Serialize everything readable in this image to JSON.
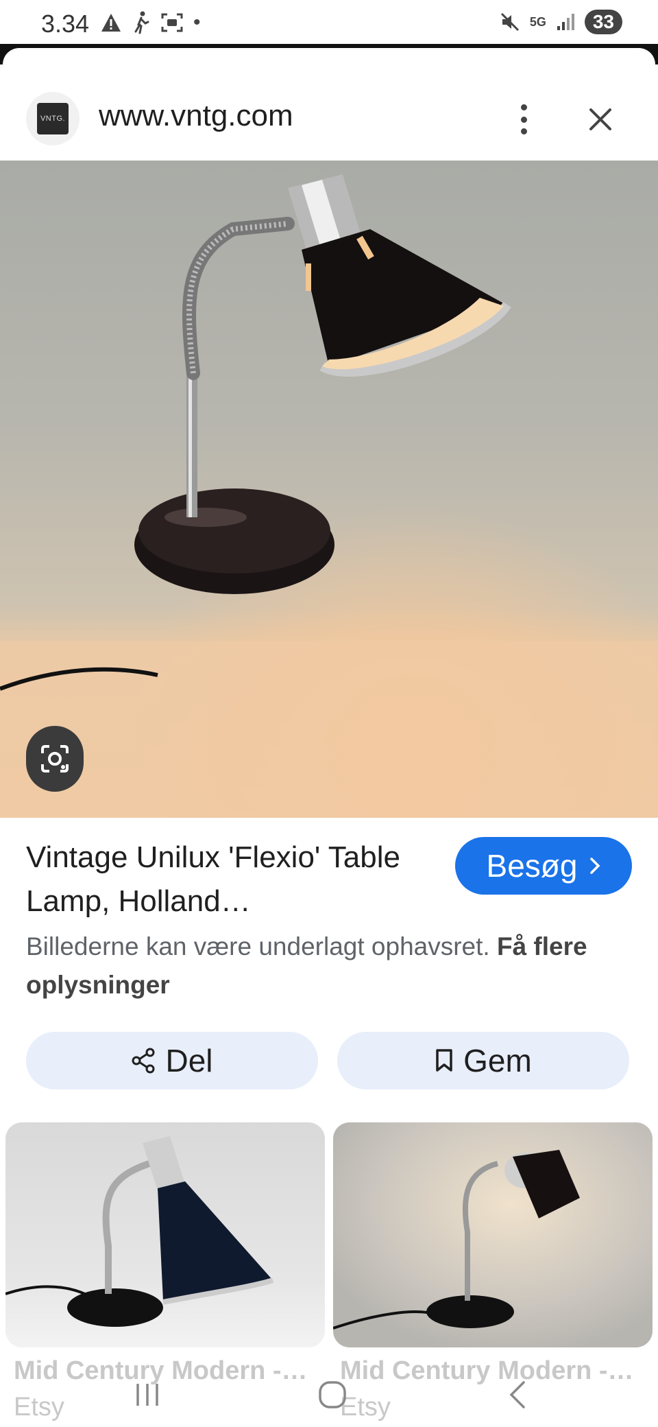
{
  "status_bar": {
    "time": "3.34",
    "network": "5G",
    "battery": "33"
  },
  "header": {
    "favicon_text": "VNTG.",
    "url": "www.vntg.com",
    "menu_icon": "more-vert-icon",
    "close_icon": "close-icon"
  },
  "image": {
    "subject": "table lamp photo",
    "lens_icon": "google-lens-icon"
  },
  "result": {
    "title": "Vintage Unilux 'Flexio' Table Lamp, Holland…",
    "visit_label": "Besøg",
    "copyright_text": "Billederne kan være underlagt ophavsret.",
    "copyright_link": "Få flere oplysninger"
  },
  "actions": {
    "share_label": "Del",
    "save_label": "Gem"
  },
  "related": [
    {
      "title": "Mid Century Modern -…",
      "source": "Etsy"
    },
    {
      "title": "Mid Century Modern -…",
      "source": "Etsy"
    }
  ],
  "colors": {
    "accent": "#1a73e8",
    "action_bg": "#e8eefa",
    "text": "#1f1f1f",
    "muted": "#5f6368"
  }
}
